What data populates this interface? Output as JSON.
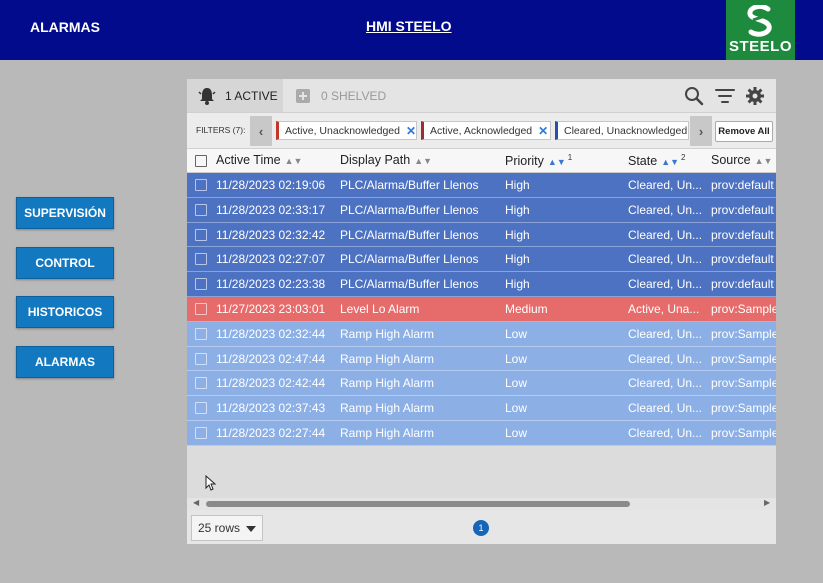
{
  "header": {
    "title": "ALARMAS",
    "center_title": "HMI STEELO",
    "logo_text": "STEELO",
    "bg_color": "#010b8c",
    "logo_color": "#1e8a3e"
  },
  "nav": {
    "items": [
      {
        "label": "SUPERVISIÓN"
      },
      {
        "label": "CONTROL"
      },
      {
        "label": "HISTORICOS"
      },
      {
        "label": "ALARMAS"
      }
    ]
  },
  "alarm_table": {
    "tabs": {
      "active_label": "1 ACTIVE",
      "shelved_label": "0 SHELVED"
    },
    "toolbar_icons": [
      "search-icon",
      "filter-icon",
      "gear-icon"
    ],
    "filters": {
      "label": "FILTERS (7):",
      "chips": [
        {
          "text": "Active, Unacknowledged",
          "color": "#c0392b"
        },
        {
          "text": "Active, Acknowledged",
          "color": "#9b2f2f"
        },
        {
          "text": "Cleared, Unacknowledged",
          "color": "#2a4fa8"
        }
      ],
      "remove_all_label": "Remove All"
    },
    "columns": [
      {
        "label": "Active Time"
      },
      {
        "label": "Display Path"
      },
      {
        "label": "Priority",
        "sort_order": "1"
      },
      {
        "label": "State",
        "sort_order": "2"
      },
      {
        "label": "Source"
      }
    ],
    "rows": [
      {
        "time": "11/28/2023 02:19:06",
        "path": "PLC/Alarma/Buffer Llenos",
        "priority": "High",
        "state": "Cleared, Un...",
        "source": "prov:default"
      },
      {
        "time": "11/28/2023 02:33:17",
        "path": "PLC/Alarma/Buffer Llenos",
        "priority": "High",
        "state": "Cleared, Un...",
        "source": "prov:default"
      },
      {
        "time": "11/28/2023 02:32:42",
        "path": "PLC/Alarma/Buffer Llenos",
        "priority": "High",
        "state": "Cleared, Un...",
        "source": "prov:default"
      },
      {
        "time": "11/28/2023 02:27:07",
        "path": "PLC/Alarma/Buffer Llenos",
        "priority": "High",
        "state": "Cleared, Un...",
        "source": "prov:default"
      },
      {
        "time": "11/28/2023 02:23:38",
        "path": "PLC/Alarma/Buffer Llenos",
        "priority": "High",
        "state": "Cleared, Un...",
        "source": "prov:default"
      },
      {
        "time": "11/27/2023 23:03:01",
        "path": "Level Lo Alarm",
        "priority": "Medium",
        "state": "Active, Una...",
        "source": "prov:Sample"
      },
      {
        "time": "11/28/2023 02:32:44",
        "path": "Ramp High Alarm",
        "priority": "Low",
        "state": "Cleared, Un...",
        "source": "prov:Sample"
      },
      {
        "time": "11/28/2023 02:47:44",
        "path": "Ramp High Alarm",
        "priority": "Low",
        "state": "Cleared, Un...",
        "source": "prov:Sample"
      },
      {
        "time": "11/28/2023 02:42:44",
        "path": "Ramp High Alarm",
        "priority": "Low",
        "state": "Cleared, Un...",
        "source": "prov:Sample"
      },
      {
        "time": "11/28/2023 02:37:43",
        "path": "Ramp High Alarm",
        "priority": "Low",
        "state": "Cleared, Un...",
        "source": "prov:Sample"
      },
      {
        "time": "11/28/2023 02:27:44",
        "path": "Ramp High Alarm",
        "priority": "Low",
        "state": "Cleared, Un...",
        "source": "prov:Sample"
      }
    ],
    "footer": {
      "rows_per_page": "25 rows",
      "page": "1"
    }
  }
}
